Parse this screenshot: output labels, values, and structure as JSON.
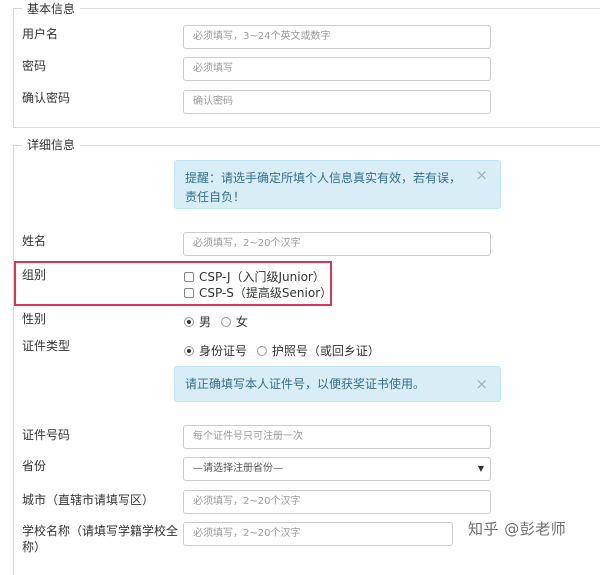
{
  "basic": {
    "legend": "基本信息",
    "username": {
      "label": "用户名",
      "placeholder": "必须填写，3~24个英文或数字"
    },
    "password": {
      "label": "密码",
      "placeholder": "必须填写"
    },
    "confirm": {
      "label": "确认密码",
      "placeholder": "确认密码"
    }
  },
  "detail": {
    "legend": "详细信息",
    "notice": "提醒：请选手确定所填个人信息真实有效，若有误，责任自负！",
    "name": {
      "label": "姓名",
      "placeholder": "必须填写，2~20个汉字"
    },
    "group": {
      "label": "组别",
      "options": [
        "CSP-J（入门级Junior）",
        "CSP-S（提高级Senior）"
      ]
    },
    "gender": {
      "label": "性别",
      "options": [
        "男",
        "女"
      ],
      "selected": "男"
    },
    "idtype": {
      "label": "证件类型",
      "options": [
        "身份证号",
        "护照号（或回乡证）"
      ],
      "selected": "身份证号"
    },
    "id_notice": "请正确填写本人证件号，以便获奖证书使用。",
    "idnum": {
      "label": "证件号码",
      "placeholder": "每个证件号只可注册一次"
    },
    "province": {
      "label": "省份",
      "selected": "—请选择注册省份—"
    },
    "city": {
      "label": "城市（直辖市请填写区）",
      "placeholder": "必须填写，2~20个汉字"
    },
    "school": {
      "label_line1": "学校名称（请填写学籍学校全",
      "label_line2": "称）",
      "placeholder": "必须填写，2~20个汉字"
    }
  },
  "icons": {
    "close": "×",
    "dropdown": "▼"
  },
  "colors": {
    "alert_bg": "#d9edf7",
    "alert_text": "#31708f",
    "highlight": "#d9345a"
  },
  "watermark": "知乎 @彭老师"
}
